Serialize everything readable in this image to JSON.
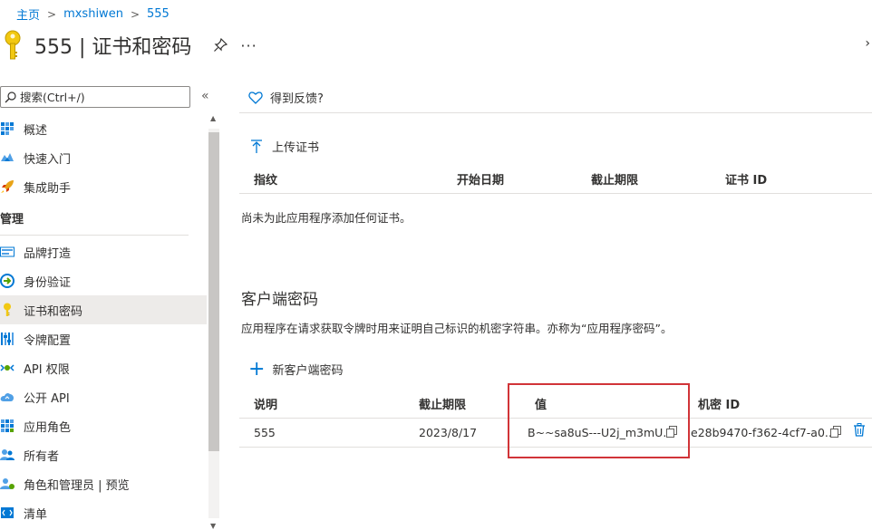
{
  "breadcrumb": {
    "items": [
      "主页",
      "mxshiwen",
      "555"
    ],
    "separator": ">"
  },
  "header": {
    "title": "555 | 证书和密码",
    "more": "···"
  },
  "sidebar": {
    "search_placeholder": "搜索(Ctrl+/)",
    "collapse": "«",
    "items_top": [
      {
        "label": "概述",
        "icon": "overview-icon"
      },
      {
        "label": "快速入门",
        "icon": "quickstart-icon"
      },
      {
        "label": "集成助手",
        "icon": "rocket-icon"
      }
    ],
    "section": "管理",
    "items_manage": [
      {
        "label": "品牌打造",
        "icon": "branding-icon"
      },
      {
        "label": "身份验证",
        "icon": "authentication-icon"
      },
      {
        "label": "证书和密码",
        "icon": "key-icon",
        "active": true
      },
      {
        "label": "令牌配置",
        "icon": "token-icon"
      },
      {
        "label": "API 权限",
        "icon": "api-permissions-icon"
      },
      {
        "label": "公开 API",
        "icon": "cloud-icon"
      },
      {
        "label": "应用角色",
        "icon": "app-roles-icon"
      },
      {
        "label": "所有者",
        "icon": "owners-icon"
      },
      {
        "label": "角色和管理员 | 预览",
        "icon": "roles-admins-icon"
      },
      {
        "label": "清单",
        "icon": "manifest-icon"
      }
    ]
  },
  "main": {
    "feedback": "得到反馈?",
    "upload_cert": "上传证书",
    "cert_columns": [
      "指纹",
      "开始日期",
      "截止期限",
      "证书 ID"
    ],
    "cert_empty": "尚未为此应用程序添加任何证书。",
    "client_title": "客户端密码",
    "client_desc": "应用程序在请求获取令牌时用来证明自己标识的机密字符串。亦称为“应用程序密码”。",
    "new_secret": "新客户端密码",
    "secret_columns": [
      "说明",
      "截止期限",
      "值",
      "机密 ID"
    ],
    "secrets": [
      {
        "description": "555",
        "expires": "2023/8/17",
        "value": "B~~sa8uS---U2j_m3mU...",
        "secret_id": "e28b9470-f362-4cf7-a0..."
      }
    ]
  },
  "colors": {
    "accent": "#0078d4",
    "highlight": "#d13438",
    "key_yellow": "#f2c811"
  }
}
